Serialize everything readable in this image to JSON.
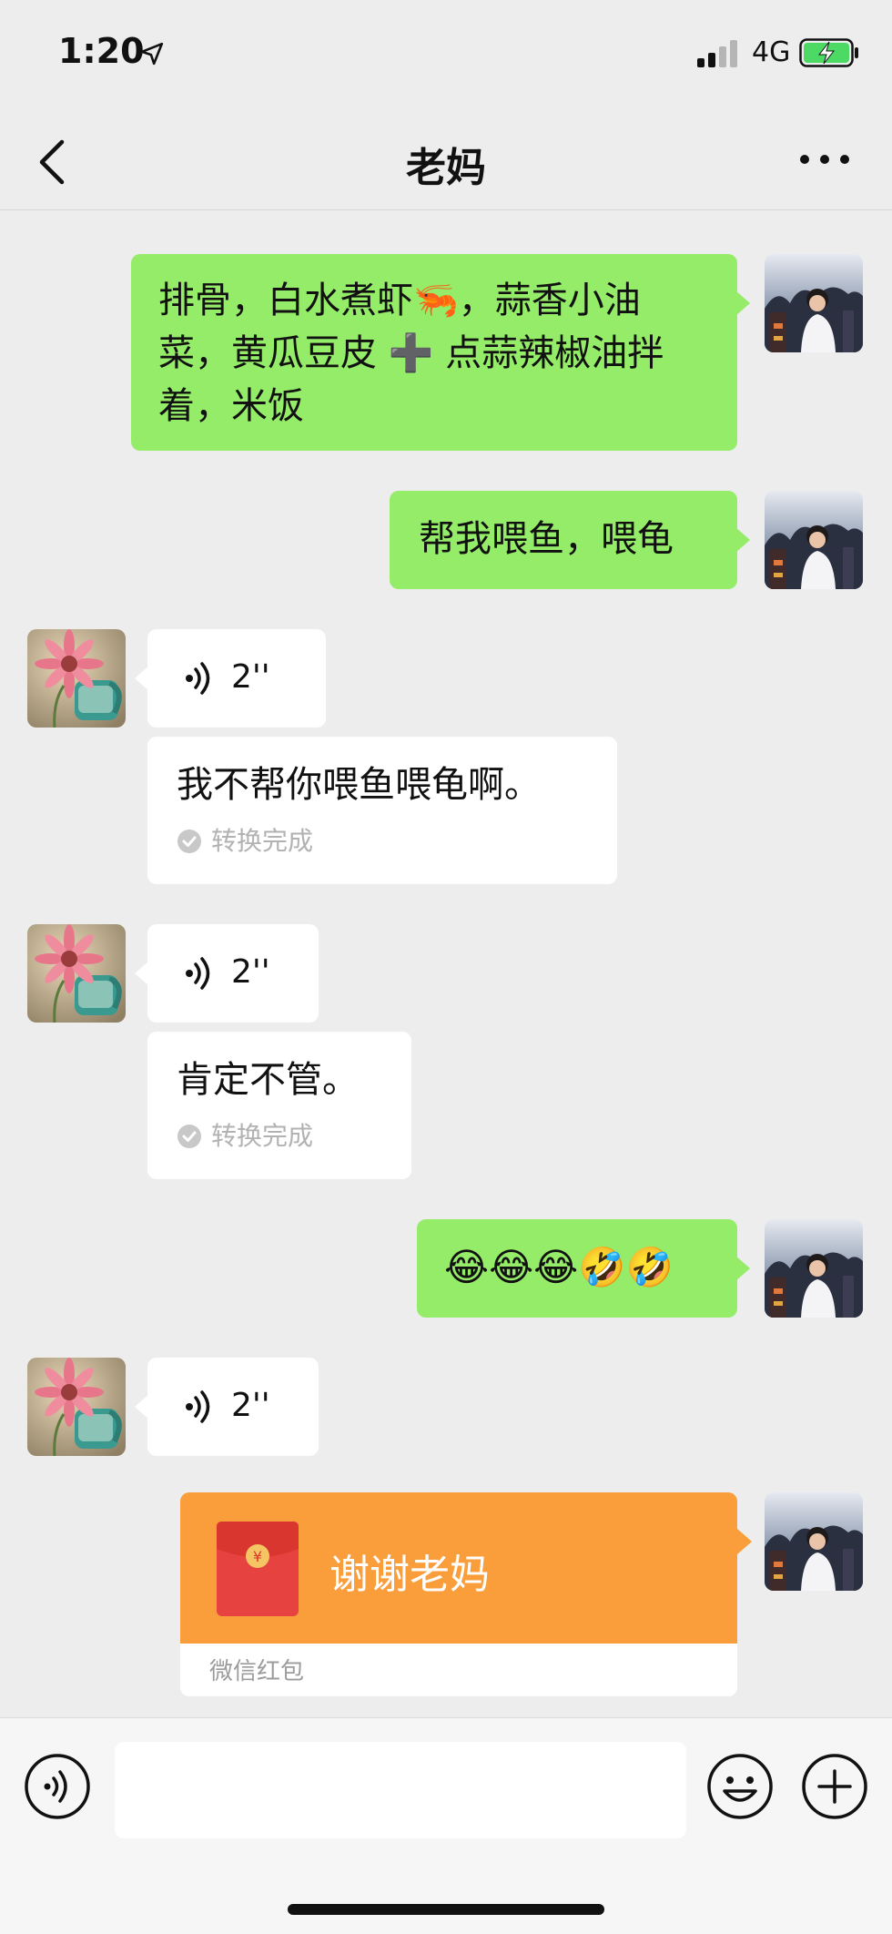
{
  "status_bar": {
    "time": "1:20",
    "network": "4G",
    "battery_charging": true
  },
  "header": {
    "title": "老妈",
    "back_icon": "chevron-left-icon",
    "more_icon": "more-dots-icon"
  },
  "messages": [
    {
      "sender": "me",
      "type": "text",
      "lines": [
        "排骨，白水煮虾🦐，蒜香小油",
        "菜，黄瓜豆皮 ➕ 点蒜辣椒油拌",
        "着，米饭"
      ]
    },
    {
      "sender": "me",
      "type": "text",
      "text": "帮我喂鱼，喂龟"
    },
    {
      "sender": "mom",
      "type": "voice",
      "duration": "2''",
      "transcript": "我不帮你喂鱼喂龟啊。",
      "transcript_status": "转换完成"
    },
    {
      "sender": "mom",
      "type": "voice",
      "duration": "2''",
      "transcript": "肯定不管。",
      "transcript_status": "转换完成"
    },
    {
      "sender": "me",
      "type": "text",
      "text": "😂😂😂🤣🤣"
    },
    {
      "sender": "mom",
      "type": "voice",
      "duration": "2''"
    },
    {
      "sender": "me",
      "type": "red_packet",
      "message": "谢谢老妈",
      "label": "微信红包",
      "symbol": "¥"
    }
  ],
  "input_bar": {
    "placeholder": "",
    "voice_icon": "voice-mode-icon",
    "emoji_icon": "emoji-icon",
    "plus_icon": "plus-circle-icon"
  },
  "colors": {
    "background": "#ededed",
    "my_bubble": "#95ec69",
    "their_bubble": "#ffffff",
    "red_packet": "#fa9d3b",
    "envelope": "#e64340"
  }
}
